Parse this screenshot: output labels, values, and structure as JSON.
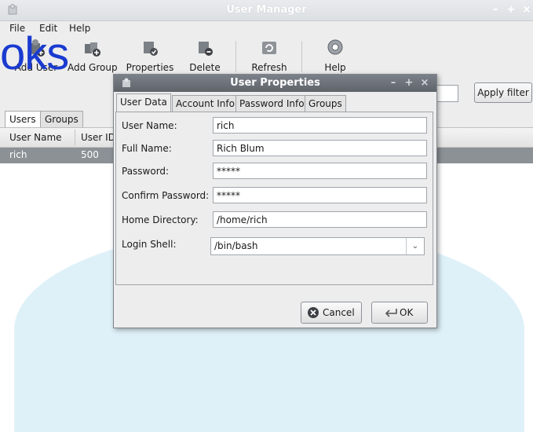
{
  "window": {
    "title": "User Manager"
  },
  "watermark_text": "oks",
  "menu": {
    "file": "File",
    "edit": "Edit",
    "help": "Help"
  },
  "toolbar": {
    "add_user": "Add User",
    "add_group": "Add Group",
    "properties": "Properties",
    "delete": "Delete",
    "refresh": "Refresh",
    "help": "Help"
  },
  "filter": {
    "apply_label": "Apply filter",
    "value": ""
  },
  "main_tabs": {
    "users": "Users",
    "groups": "Groups"
  },
  "list": {
    "columns": [
      "User Name",
      "User ID"
    ],
    "rows": [
      {
        "name": "rich",
        "uid": "500"
      }
    ]
  },
  "dialog": {
    "title": "User Properties",
    "tabs": [
      "User Data",
      "Account Info",
      "Password Info",
      "Groups"
    ],
    "fields": {
      "user_name": {
        "label": "User Name:",
        "value": "rich"
      },
      "full_name": {
        "label": "Full Name:",
        "value": "Rich Blum"
      },
      "password": {
        "label": "Password:",
        "value": "*****"
      },
      "confirm_password": {
        "label": "Confirm Password:",
        "value": "*****"
      },
      "home_directory": {
        "label": "Home Directory:",
        "value": "/home/rich"
      },
      "login_shell": {
        "label": "Login Shell:",
        "value": "/bin/bash"
      }
    },
    "cancel_label": "Cancel",
    "ok_label": "OK"
  },
  "colors": {
    "selection_row": "#8c9196",
    "dialog_titlebar": "#5f646b",
    "watermark_logo": "#1a3bd0",
    "watermark_shape": "#dff1f8"
  }
}
